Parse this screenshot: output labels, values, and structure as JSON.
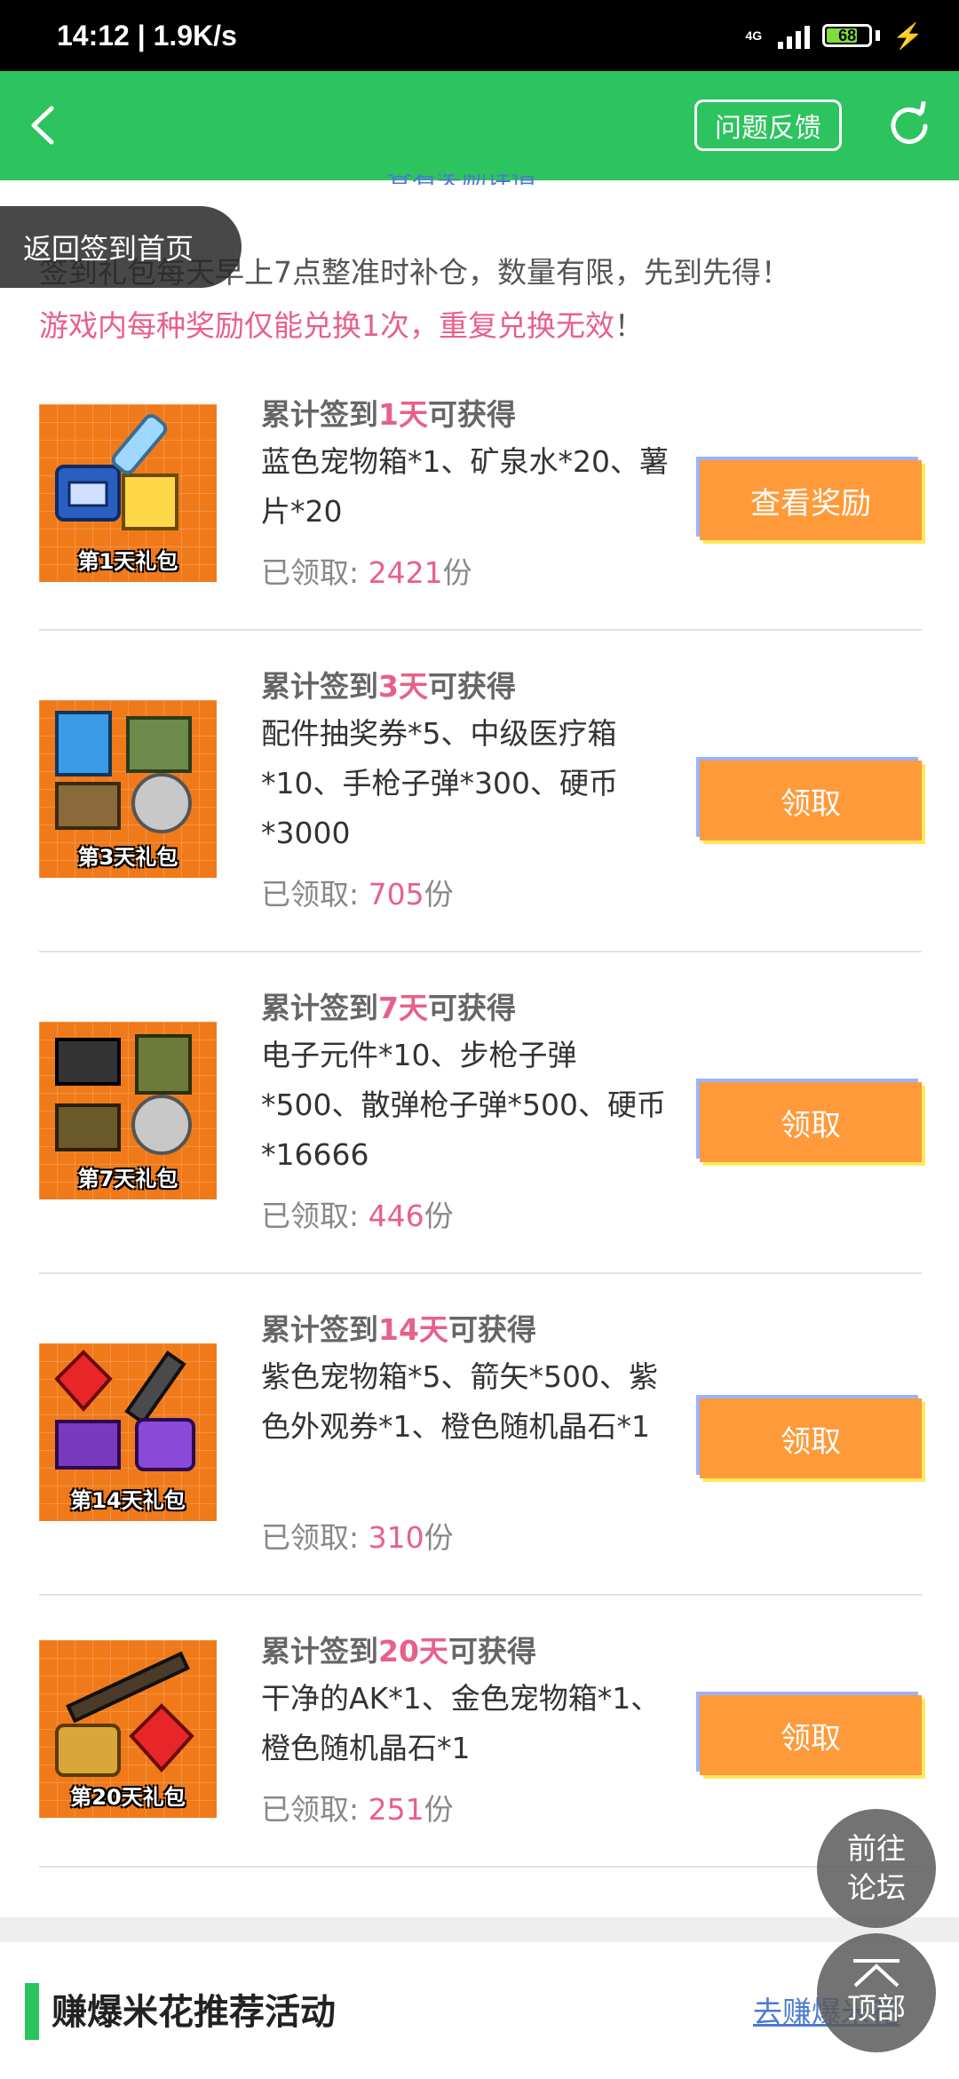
{
  "status": {
    "time_speed": "14:12 | 1.9K/s",
    "network": "4G",
    "battery": "68"
  },
  "app_bar": {
    "feedback_label": "问题反馈"
  },
  "top_link": "查看奖励详情",
  "return_label": "返回签到首页",
  "notice": {
    "line1": "签到礼包每天早上7点整准时补仓，数量有限，先到先得！",
    "line2": "游戏内每种奖励仅能兑换1次，重复兑换无效",
    "line2_mark": "！"
  },
  "rewards": [
    {
      "title_prefix": "累计签到",
      "days": "1天",
      "title_suffix": "可获得",
      "desc": "蓝色宠物箱*1、矿泉水*20、薯片*20",
      "claimed_label": "已领取: ",
      "claimed_count": "2421",
      "unit": "份",
      "gift_label": "第1天礼包",
      "button": "查看奖励"
    },
    {
      "title_prefix": "累计签到",
      "days": "3天",
      "title_suffix": "可获得",
      "desc": "配件抽奖券*5、中级医疗箱*10、手枪子弹*300、硬币*3000",
      "claimed_label": "已领取: ",
      "claimed_count": "705",
      "unit": "份",
      "gift_label": "第3天礼包",
      "button": "领取"
    },
    {
      "title_prefix": "累计签到",
      "days": "7天",
      "title_suffix": "可获得",
      "desc": "电子元件*10、步枪子弹*500、散弹枪子弹*500、硬币*16666",
      "claimed_label": "已领取: ",
      "claimed_count": "446",
      "unit": "份",
      "gift_label": "第7天礼包",
      "button": "领取"
    },
    {
      "title_prefix": "累计签到",
      "days": "14天",
      "title_suffix": "可获得",
      "desc": "紫色宠物箱*5、箭矢*500、紫色外观券*1、橙色随机晶石*1",
      "claimed_label": "已领取: ",
      "claimed_count": "310",
      "unit": "份",
      "gift_label": "第14天礼包",
      "button": "领取"
    },
    {
      "title_prefix": "累计签到",
      "days": "20天",
      "title_suffix": "可获得",
      "desc": "干净的AK*1、金色宠物箱*1、橙色随机晶石*1",
      "claimed_label": "已领取: ",
      "claimed_count": "251",
      "unit": "份",
      "gift_label": "第20天礼包",
      "button": "领取"
    }
  ],
  "section": {
    "title": "赚爆米花推荐活动",
    "link": "去赚爆米花"
  },
  "float": {
    "forum_line1": "前往",
    "forum_line2": "论坛",
    "top_label": "顶部"
  },
  "colors": {
    "brand_green": "#2dc35f",
    "highlight_pink": "#e8608a",
    "button_orange": "#ff9a3a"
  }
}
